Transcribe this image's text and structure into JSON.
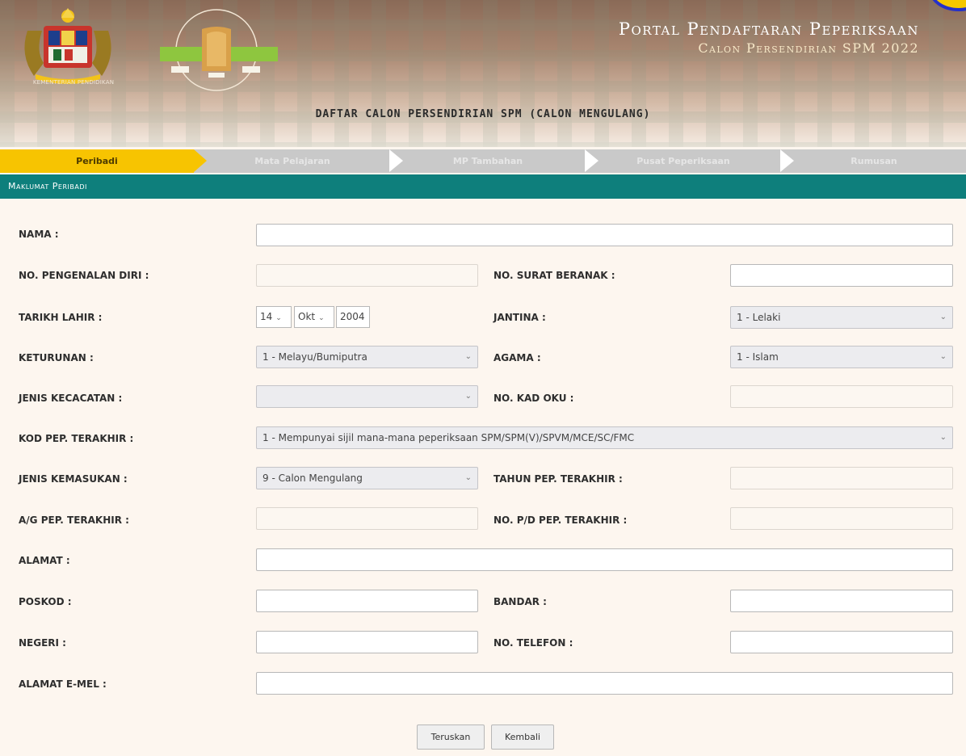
{
  "header": {
    "crest_caption": "KEMENTERIAN PENDIDIKAN",
    "portal_title": "Portal Pendaftaran Peperiksaan",
    "portal_subtitle": "Calon Persendirian SPM 2022",
    "page_heading": "DAFTAR CALON PERSENDIRIAN SPM (CALON MENGULANG)"
  },
  "steps": [
    {
      "label": "Peribadi",
      "active": true
    },
    {
      "label": "Mata Pelajaran",
      "active": false
    },
    {
      "label": "MP Tambahan",
      "active": false
    },
    {
      "label": "Pusat Peperiksaan",
      "active": false
    },
    {
      "label": "Rumusan",
      "active": false
    }
  ],
  "section": {
    "title": "Maklumat Peribadi"
  },
  "form": {
    "nama": {
      "label": "NAMA :",
      "value": ""
    },
    "no_pengenalan": {
      "label": "NO. PENGENALAN DIRI :",
      "value": ""
    },
    "no_surat_beranak": {
      "label": "NO. SURAT BERANAK :",
      "value": ""
    },
    "tarikh_lahir": {
      "label": "TARIKH LAHIR :",
      "day": "14",
      "month": "Okt",
      "year": "2004"
    },
    "jantina": {
      "label": "JANTINA :",
      "value": "1 - Lelaki"
    },
    "keturunan": {
      "label": "KETURUNAN :",
      "value": "1 - Melayu/Bumiputra"
    },
    "agama": {
      "label": "AGAMA :",
      "value": "1 - Islam"
    },
    "jenis_kecacatan": {
      "label": "JENIS KECACATAN :",
      "value": ""
    },
    "no_kad_oku": {
      "label": "NO. KAD OKU :",
      "value": ""
    },
    "kod_pep_terakhir": {
      "label": "KOD PEP. TERAKHIR :",
      "value": "1 - Mempunyai sijil mana-mana peperiksaan SPM/SPM(V)/SPVM/MCE/SC/FMC"
    },
    "jenis_kemasukan": {
      "label": "JENIS KEMASUKAN :",
      "value": "9 - Calon Mengulang"
    },
    "tahun_pep_terakhir": {
      "label": "TAHUN PEP. TERAKHIR :",
      "value": ""
    },
    "ag_pep_terakhir": {
      "label": "A/G PEP. TERAKHIR :",
      "value": ""
    },
    "no_pd_pep_terakhir": {
      "label": "NO. P/D PEP. TERAKHIR :",
      "value": ""
    },
    "alamat": {
      "label": "ALAMAT :",
      "value": ""
    },
    "poskod": {
      "label": "POSKOD :",
      "value": ""
    },
    "bandar": {
      "label": "BANDAR :",
      "value": ""
    },
    "negeri": {
      "label": "NEGERI :",
      "value": ""
    },
    "no_telefon": {
      "label": "NO. TELEFON :",
      "value": ""
    },
    "alamat_emel": {
      "label": "ALAMAT E-MEL :",
      "value": ""
    }
  },
  "buttons": {
    "teruskan": "Teruskan",
    "kembali": "Kembali"
  },
  "colors": {
    "accent_yellow": "#f7c401",
    "teal": "#0e7f7c",
    "step_gray": "#c9c9c9"
  }
}
